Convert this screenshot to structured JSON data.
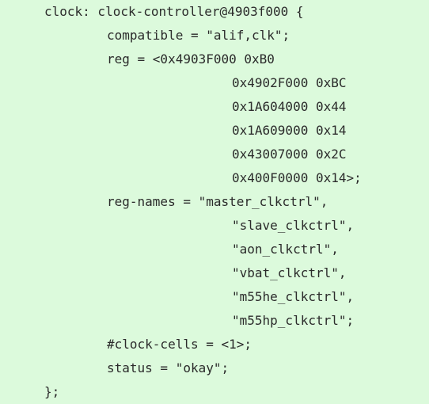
{
  "code": {
    "lines": [
      "clock: clock-controller@4903f000 {",
      "compatible = \"alif,clk\";",
      "reg = <0x4903F000 0xB0",
      "0x4902F000 0xBC",
      "0x1A604000 0x44",
      "0x1A609000 0x14",
      "0x43007000 0x2C",
      "0x400F0000 0x14>;",
      "reg-names = \"master_clkctrl\",",
      "\"slave_clkctrl\",",
      "\"aon_clkctrl\",",
      "\"vbat_clkctrl\",",
      "\"m55he_clkctrl\",",
      "\"m55hp_clkctrl\";",
      "#clock-cells = <1>;",
      "status = \"okay\";",
      "};"
    ]
  }
}
